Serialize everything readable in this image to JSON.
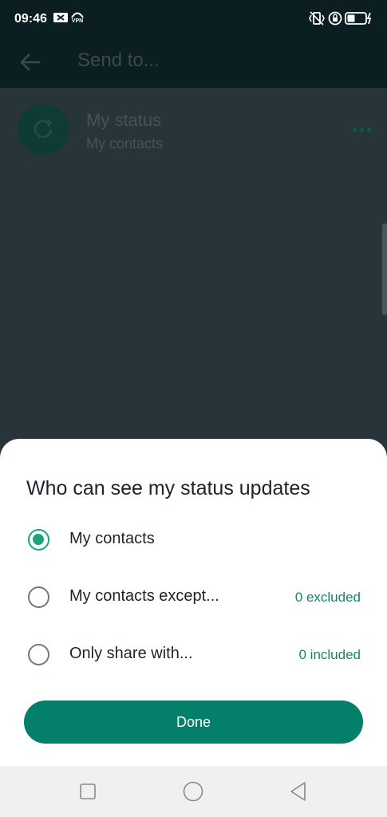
{
  "status_bar": {
    "time": "09:46",
    "icons": [
      "mail-x-icon",
      "vpn-icon",
      "vibrate-icon",
      "rotation-lock-icon",
      "battery-charging-icon"
    ],
    "vpn_label": "VPN"
  },
  "app_bar": {
    "title": "Send to...",
    "back_icon": "arrow-left-icon"
  },
  "status_row": {
    "title": "My status",
    "subtitle": "My contacts",
    "avatar_icon": "status-add-icon",
    "more_icon": "more-horizontal-icon"
  },
  "sheet": {
    "title": "Who can see my status updates",
    "options": [
      {
        "label": "My contacts",
        "count": "",
        "selected": true
      },
      {
        "label": "My contacts except...",
        "count": "0 excluded",
        "selected": false
      },
      {
        "label": "Only share with...",
        "count": "0 included",
        "selected": false
      }
    ],
    "done_label": "Done"
  },
  "nav_bar": {
    "icons": [
      "recents-square-icon",
      "home-circle-icon",
      "back-triangle-icon"
    ]
  },
  "colors": {
    "accent": "#04806a",
    "radio_selected": "#1aa37e",
    "count_text": "#0e8a6d",
    "app_bar_dim": "#0b1f23",
    "background_dim": "#27343a"
  }
}
